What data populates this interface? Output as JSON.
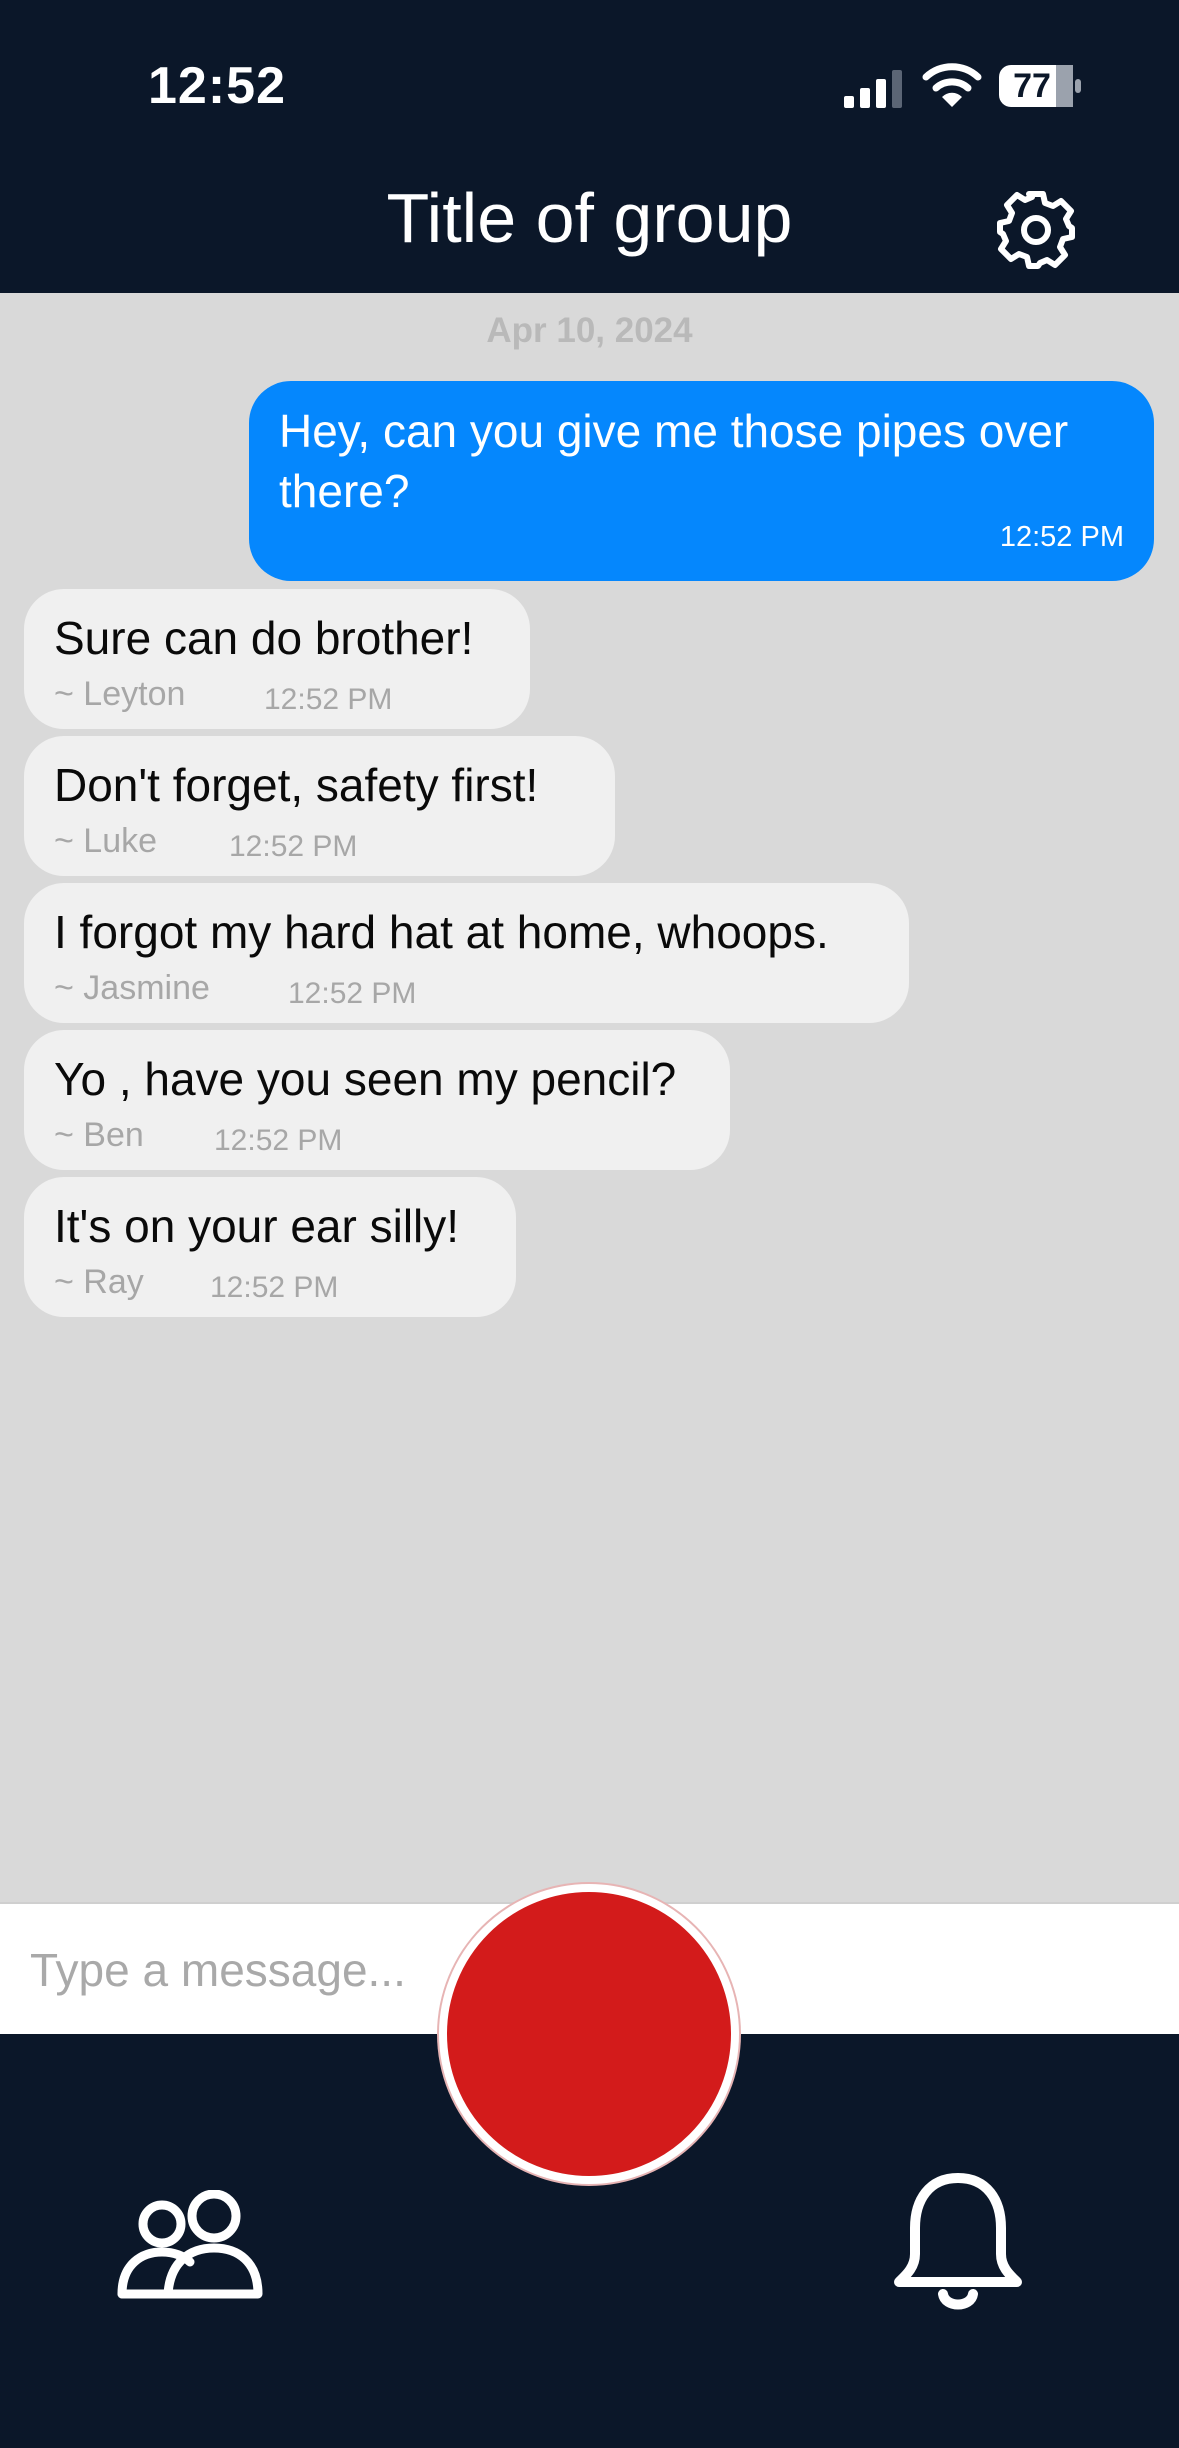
{
  "status_bar": {
    "time": "12:52",
    "battery": "77"
  },
  "header": {
    "title": "Title of group",
    "settings_icon": "gear-icon"
  },
  "chat": {
    "date": "Apr 10, 2024",
    "outgoing": [
      {
        "text": "Hey, can you give me those pipes over there?",
        "time": "12:52 PM"
      }
    ],
    "incoming": [
      {
        "text": "Sure can do brother!",
        "sender": "~ Leyton",
        "time": "12:52 PM"
      },
      {
        "text": "Don't forget, safety first!",
        "sender": "~ Luke",
        "time": "12:52 PM"
      },
      {
        "text": "I forgot my hard hat at home, whoops.",
        "sender": "~ Jasmine",
        "time": "12:52 PM"
      },
      {
        "text": "Yo , have you seen my pencil?",
        "sender": "~ Ben",
        "time": "12:52 PM"
      },
      {
        "text": "It's on your ear silly!",
        "sender": "~ Ray",
        "time": "12:52 PM"
      }
    ]
  },
  "composer": {
    "placeholder": "Type a message..."
  },
  "tab_bar": {
    "left_icon": "people-icon",
    "center_button": "record-button",
    "right_icon": "bell-icon"
  },
  "colors": {
    "navy": "#0b1729",
    "chat_background": "#d9d9d9",
    "outgoing_bubble": "#0587fd",
    "incoming_bubble": "#f0f0f0",
    "record_red": "#d31b1b"
  }
}
